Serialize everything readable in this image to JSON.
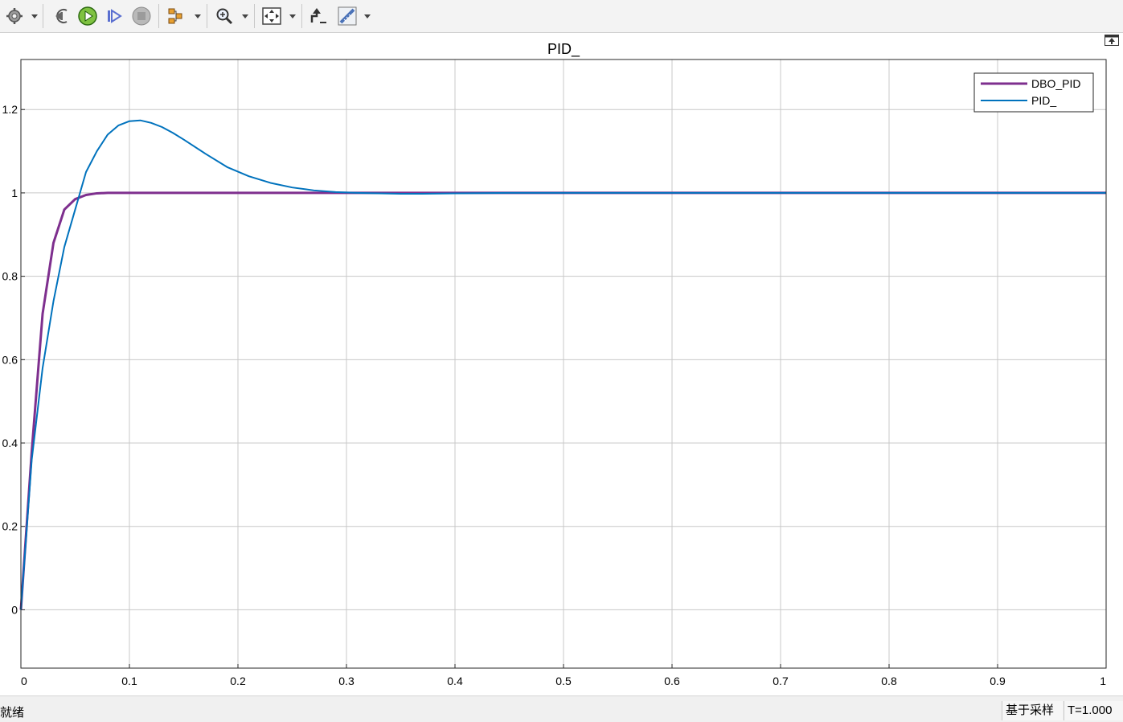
{
  "toolbar": {
    "buttons": [
      {
        "id": "settings",
        "icon": "gear-icon",
        "dropdown": true
      },
      {
        "id": "step-back",
        "icon": "step-back-icon",
        "dropdown": false
      },
      {
        "id": "run",
        "icon": "run-icon",
        "dropdown": false
      },
      {
        "id": "step-forward",
        "icon": "step-forward-icon",
        "dropdown": false
      },
      {
        "id": "stop",
        "icon": "stop-icon",
        "dropdown": false
      },
      {
        "id": "highlight",
        "icon": "signal-highlight-icon",
        "dropdown": true
      },
      {
        "id": "zoom",
        "icon": "zoom-in-icon",
        "dropdown": true
      },
      {
        "id": "autoscale",
        "icon": "fit-to-view-icon",
        "dropdown": true
      },
      {
        "id": "trigger",
        "icon": "trigger-icon",
        "dropdown": false
      },
      {
        "id": "measure",
        "icon": "cursor-measure-icon",
        "dropdown": true
      }
    ]
  },
  "plot": {
    "undock_icon": "undock-icon",
    "colors": {
      "dbo_pid": "#7e2f8e",
      "pid": "#0072bd",
      "grid": "#c8c8c8",
      "axes": "#262626"
    }
  },
  "chart_data": {
    "type": "line",
    "title": "PID_",
    "xlabel": "",
    "ylabel": "",
    "xlim": [
      0,
      1
    ],
    "ylim": [
      -0.14,
      1.32
    ],
    "xticks": [
      "0",
      "0.1",
      "0.2",
      "0.3",
      "0.4",
      "0.5",
      "0.6",
      "0.7",
      "0.8",
      "0.9",
      "1"
    ],
    "yticks": [
      "0",
      "0.2",
      "0.4",
      "0.6",
      "0.8",
      "1",
      "1.2"
    ],
    "grid": true,
    "legend_position": "top-right",
    "series": [
      {
        "name": "DBO_PID",
        "color": "#7e2f8e",
        "x": [
          0,
          0.01,
          0.02,
          0.03,
          0.04,
          0.05,
          0.06,
          0.07,
          0.08,
          0.1,
          0.15,
          0.2,
          0.3,
          0.4,
          0.5,
          0.6,
          0.7,
          0.8,
          0.9,
          1.0
        ],
        "y": [
          0,
          0.38,
          0.71,
          0.88,
          0.96,
          0.985,
          0.995,
          0.999,
          1.0,
          1.0,
          1.0,
          1.0,
          1.0,
          1.0,
          1.0,
          1.0,
          1.0,
          1.0,
          1.0,
          1.0
        ]
      },
      {
        "name": "PID_",
        "color": "#0072bd",
        "x": [
          0,
          0.01,
          0.02,
          0.03,
          0.04,
          0.05,
          0.06,
          0.07,
          0.08,
          0.09,
          0.1,
          0.11,
          0.12,
          0.13,
          0.14,
          0.15,
          0.17,
          0.19,
          0.21,
          0.23,
          0.25,
          0.27,
          0.29,
          0.31,
          0.33,
          0.35,
          0.37,
          0.4,
          0.45,
          0.5,
          0.6,
          0.7,
          0.8,
          0.9,
          1.0
        ],
        "y": [
          0,
          0.36,
          0.58,
          0.74,
          0.87,
          0.96,
          1.05,
          1.1,
          1.14,
          1.162,
          1.172,
          1.174,
          1.168,
          1.158,
          1.144,
          1.128,
          1.094,
          1.062,
          1.04,
          1.024,
          1.013,
          1.006,
          1.002,
          1.0,
          0.999,
          0.998,
          0.998,
          0.999,
          1.0,
          1.0,
          1.0,
          1.0,
          1.0,
          1.0,
          1.0
        ]
      }
    ]
  },
  "status": {
    "ready": "就绪",
    "sample_mode": "基于采样",
    "time": "T=1.000"
  }
}
